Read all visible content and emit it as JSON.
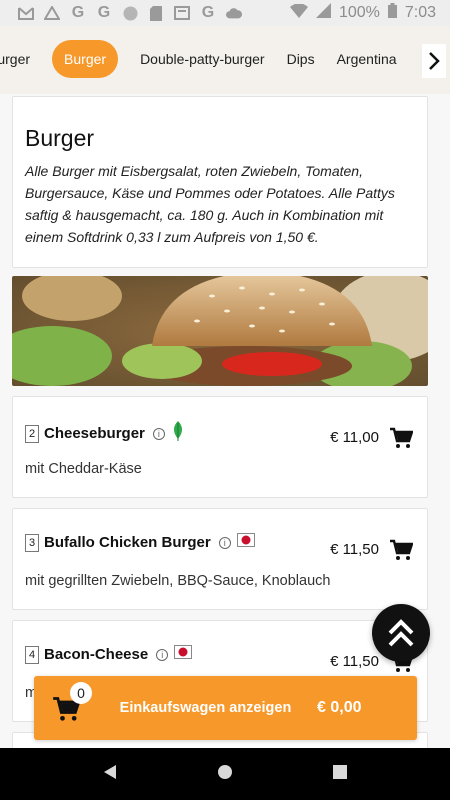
{
  "status_bar": {
    "battery": "100%",
    "time": "7:03",
    "left_icons": [
      "gmail-icon",
      "drive-icon",
      "google-icon",
      "google-icon",
      "circle-icon",
      "sd-card-icon",
      "news-icon",
      "google-icon",
      "cloud-icon"
    ],
    "right_icons": [
      "wifi-icon",
      "signal-icon",
      "battery-icon"
    ]
  },
  "categories": {
    "items": [
      "Burger",
      "Burger",
      "Double-patty-burger",
      "Dips",
      "Argentina"
    ],
    "active_index": 1,
    "accent_color": "#f7982a"
  },
  "intro": {
    "title": "Burger",
    "text": "Alle Burger mit Eisbergsalat, roten Zwiebeln, Tomaten, Burgersauce, Käse und Pommes oder Potatoes. Alle Pattys saftig & hausgemacht, ca. 180 g. Auch in Kombination mit einem Softdrink 0,33 l zum Aufpreis von 1,50 €."
  },
  "items": [
    {
      "number": "2",
      "name": "Cheeseburger",
      "price": "€ 11,00",
      "desc": "mit Cheddar-Käse",
      "tag": "leaf-icon"
    },
    {
      "number": "3",
      "name": "Bufallo Chicken Burger",
      "price": "€ 11,50",
      "desc": "mit gegrillten Zwiebeln, BBQ-Sauce, Knoblauch",
      "tag": "red-dot-icon"
    },
    {
      "number": "4",
      "name": "Bacon-Cheese",
      "price": "€ 11,50",
      "desc": "m",
      "tag": "red-dot-icon"
    }
  ],
  "cart": {
    "count": "0",
    "label": "Einkaufswagen anzeigen",
    "total": "€ 0,00"
  }
}
